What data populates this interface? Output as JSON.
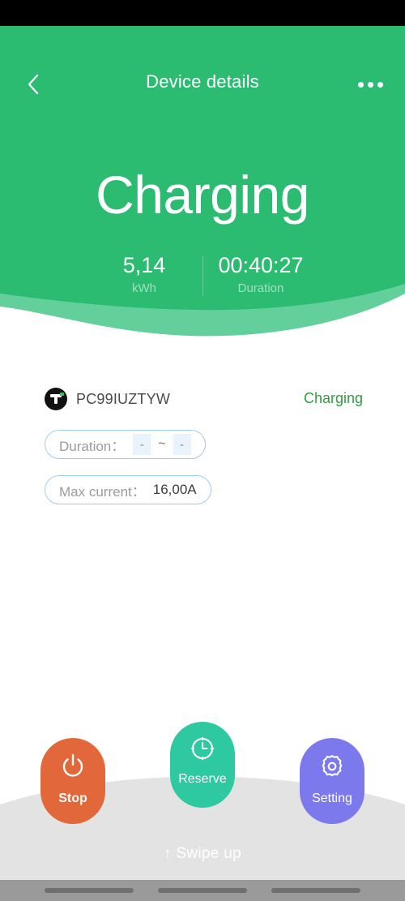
{
  "appbar": {
    "title": "Device details",
    "back_icon": "chevron-left-icon",
    "more_icon": "more-horizontal-icon"
  },
  "hero": {
    "state": "Charging",
    "stats": [
      {
        "value": "5,14",
        "label": "kWh"
      },
      {
        "value": "00:40:27",
        "label": "Duration"
      }
    ]
  },
  "device": {
    "logo_icon": "tuya-t-logo-icon",
    "id": "PC99IUZTYW",
    "status": "Charging",
    "status_color": "#2e9e3f"
  },
  "info": {
    "duration": {
      "label": "Duration：",
      "start": "-",
      "separator": "~",
      "end": "-"
    },
    "max_current": {
      "label": "Max current：",
      "value": "16,00A"
    }
  },
  "actions": [
    {
      "key": "stop",
      "label": "Stop",
      "icon": "power-icon",
      "color": "#e2673a"
    },
    {
      "key": "reserve",
      "label": "Reserve",
      "icon": "clock-icon",
      "color": "#2ec9a0"
    },
    {
      "key": "setting",
      "label": "Setting",
      "icon": "gear-icon",
      "color": "#7b79ec"
    }
  ],
  "bottom": {
    "swipe_hint": "↑ Swipe up"
  },
  "theme": {
    "primary_green": "#2bbc72",
    "wave_light_green": "#63cf9a",
    "panel_gray": "#e3e3e3",
    "pill_border_blue": "#9ecbf0",
    "chip_blue": "#eaf2fb"
  }
}
